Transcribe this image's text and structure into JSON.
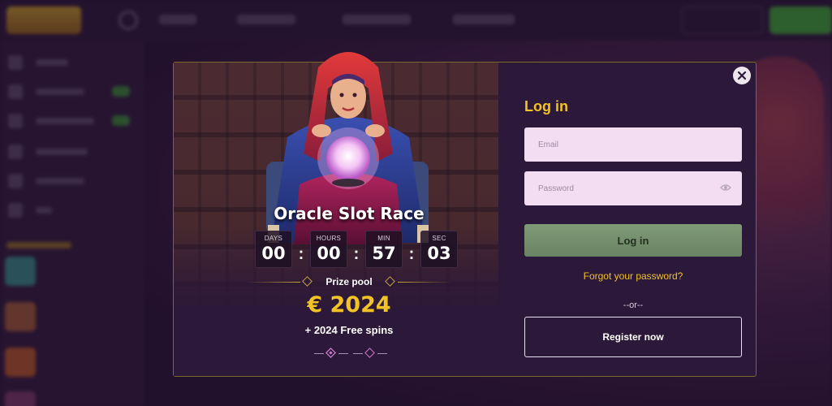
{
  "promo": {
    "title": "Oracle Slot Race",
    "countdown": [
      {
        "label": "DAYS",
        "value": "00"
      },
      {
        "label": "HOURS",
        "value": "00"
      },
      {
        "label": "MIN",
        "value": "57"
      },
      {
        "label": "SEC",
        "value": "03"
      }
    ],
    "separator": ":",
    "prize_pool_label": "Prize pool",
    "prize_amount": "€ 2024",
    "free_spins": "+ 2024 Free spins",
    "carousel_active_index": 0
  },
  "login": {
    "title": "Log in",
    "email_placeholder": "Email",
    "password_placeholder": "Password",
    "login_button": "Log in",
    "forgot_password": "Forgot your password?",
    "or_text": "--or--",
    "register_button": "Register now"
  },
  "icons": {
    "close": "close-icon",
    "show_password": "eye-icon"
  },
  "colors": {
    "accent_gold": "#f2c324",
    "login_green": "#7f9a77",
    "modal_bg": "#2c1838",
    "field_bg": "#f3ddf3"
  }
}
